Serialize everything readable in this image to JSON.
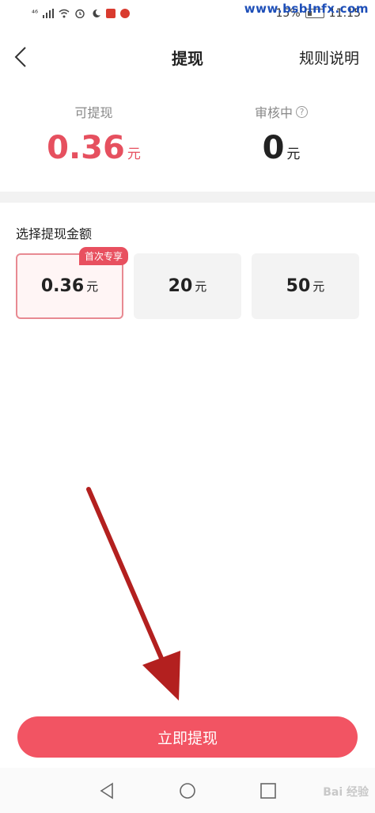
{
  "status_bar": {
    "signal_text": "⁴⁶",
    "battery_percent": "15%",
    "time": "11:15"
  },
  "watermark": "www.bsbInfx.com",
  "nav": {
    "title": "提现",
    "rules_label": "规则说明"
  },
  "balances": {
    "available_label": "可提现",
    "available_value": "0.36",
    "available_unit": "元",
    "pending_label": "审核中",
    "pending_help": "?",
    "pending_value": "0",
    "pending_unit": "元"
  },
  "select_label": "选择提现金额",
  "options": [
    {
      "value": "0.36",
      "unit": "元",
      "tag": "首次专享",
      "selected": true
    },
    {
      "value": "20",
      "unit": "元",
      "selected": false
    },
    {
      "value": "50",
      "unit": "元",
      "selected": false
    }
  ],
  "withdraw_button_label": "立即提现",
  "baidu_watermark": "Bai 经验",
  "colors": {
    "accent": "#f25463",
    "arrow": "#b3201f"
  }
}
